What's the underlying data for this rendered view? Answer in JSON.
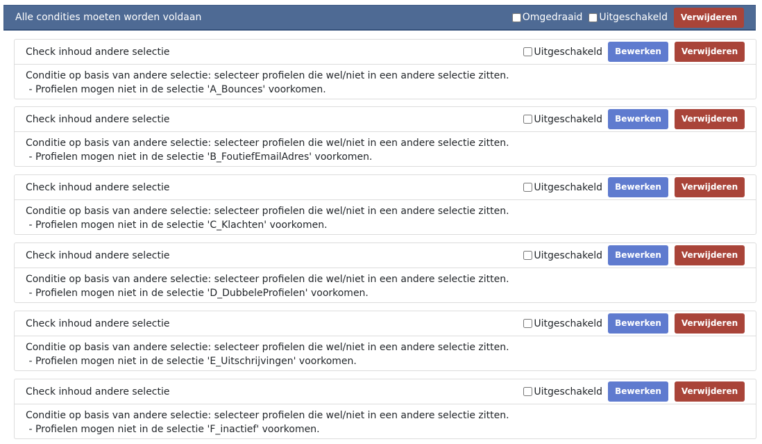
{
  "group": {
    "title": "Alle condities moeten worden voldaan",
    "inverted_label": "Omgedraaid",
    "disabled_label": "Uitgeschakeld",
    "delete_label": "Verwijderen"
  },
  "conditions": [
    {
      "title": "Check inhoud andere selectie",
      "disabled_label": "Uitgeschakeld",
      "edit_label": "Bewerken",
      "delete_label": "Verwijderen",
      "description": "Conditie op basis van andere selectie: selecteer profielen die wel/niet in een andere selectie zitten.",
      "detail": " - Profielen mogen niet in de selectie 'A_Bounces' voorkomen."
    },
    {
      "title": "Check inhoud andere selectie",
      "disabled_label": "Uitgeschakeld",
      "edit_label": "Bewerken",
      "delete_label": "Verwijderen",
      "description": "Conditie op basis van andere selectie: selecteer profielen die wel/niet in een andere selectie zitten.",
      "detail": " - Profielen mogen niet in de selectie 'B_FoutiefEmailAdres' voorkomen."
    },
    {
      "title": "Check inhoud andere selectie",
      "disabled_label": "Uitgeschakeld",
      "edit_label": "Bewerken",
      "delete_label": "Verwijderen",
      "description": "Conditie op basis van andere selectie: selecteer profielen die wel/niet in een andere selectie zitten.",
      "detail": " - Profielen mogen niet in de selectie 'C_Klachten' voorkomen."
    },
    {
      "title": "Check inhoud andere selectie",
      "disabled_label": "Uitgeschakeld",
      "edit_label": "Bewerken",
      "delete_label": "Verwijderen",
      "description": "Conditie op basis van andere selectie: selecteer profielen die wel/niet in een andere selectie zitten.",
      "detail": " - Profielen mogen niet in de selectie 'D_DubbeleProfielen' voorkomen."
    },
    {
      "title": "Check inhoud andere selectie",
      "disabled_label": "Uitgeschakeld",
      "edit_label": "Bewerken",
      "delete_label": "Verwijderen",
      "description": "Conditie op basis van andere selectie: selecteer profielen die wel/niet in een andere selectie zitten.",
      "detail": " - Profielen mogen niet in de selectie 'E_Uitschrijvingen' voorkomen."
    },
    {
      "title": "Check inhoud andere selectie",
      "disabled_label": "Uitgeschakeld",
      "edit_label": "Bewerken",
      "delete_label": "Verwijderen",
      "description": "Conditie op basis van andere selectie: selecteer profielen die wel/niet in een andere selectie zitten.",
      "detail": " - Profielen mogen niet in de selectie 'F_inactief' voorkomen."
    }
  ],
  "colors": {
    "header_bg": "#4e6a94",
    "delete_button": "#a94439",
    "edit_button": "#5f7bcf"
  }
}
